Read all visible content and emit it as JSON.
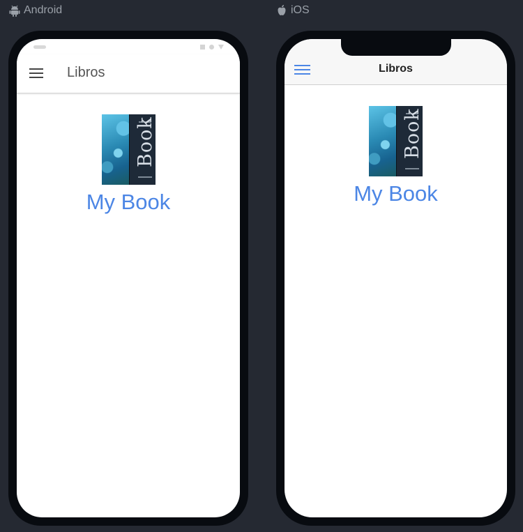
{
  "platforms": {
    "android": {
      "label": "Android",
      "icon": "android-icon"
    },
    "ios": {
      "label": "iOS",
      "icon": "apple-icon"
    }
  },
  "app": {
    "title": "Libros",
    "menu_icon": "hamburger-menu-icon",
    "book": {
      "title": "My Book",
      "cover_word": "Book"
    }
  },
  "colors": {
    "background": "#252932",
    "frame": "#080b10",
    "accent": "#4c86e5",
    "platform_label": "#9aa0a8"
  }
}
